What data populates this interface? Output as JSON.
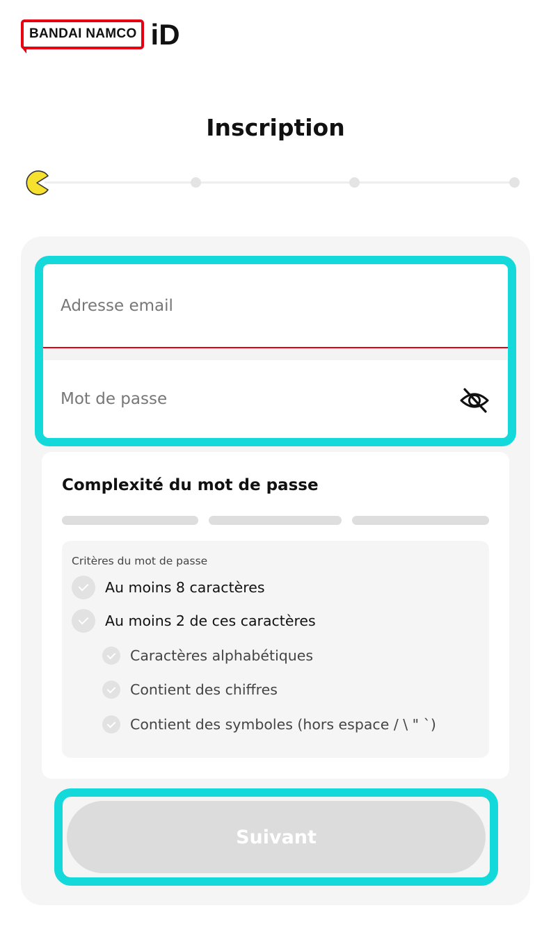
{
  "brand": {
    "logo_text": "BANDAI NAMCO",
    "id_text": "iD",
    "accent_color": "#e60012"
  },
  "page": {
    "title": "Inscription"
  },
  "stepper": {
    "current_step": 1,
    "total_steps": 4,
    "current_icon": "pacman-icon"
  },
  "form": {
    "email_placeholder": "Adresse email",
    "email_value": "",
    "password_placeholder": "Mot de passe",
    "password_value": "",
    "toggle_icon": "eye-slash-icon"
  },
  "complexity": {
    "title": "Complexité du mot de passe",
    "strength_segments": 3,
    "strength_filled": 0,
    "criteria_heading": "Critères du mot de passe",
    "criteria": [
      "Au moins 8 caractères",
      "Au moins 2 de ces caractères"
    ],
    "sub_criteria": [
      "Caractères alphabétiques",
      "Contient des chiffres",
      "Contient des symboles (hors espace / \\ \" `)"
    ]
  },
  "actions": {
    "next_label": "Suivant"
  },
  "colors": {
    "highlight": "#14d9db",
    "pacman": "#f5e12e",
    "disabled_button": "#dcdcdc"
  }
}
